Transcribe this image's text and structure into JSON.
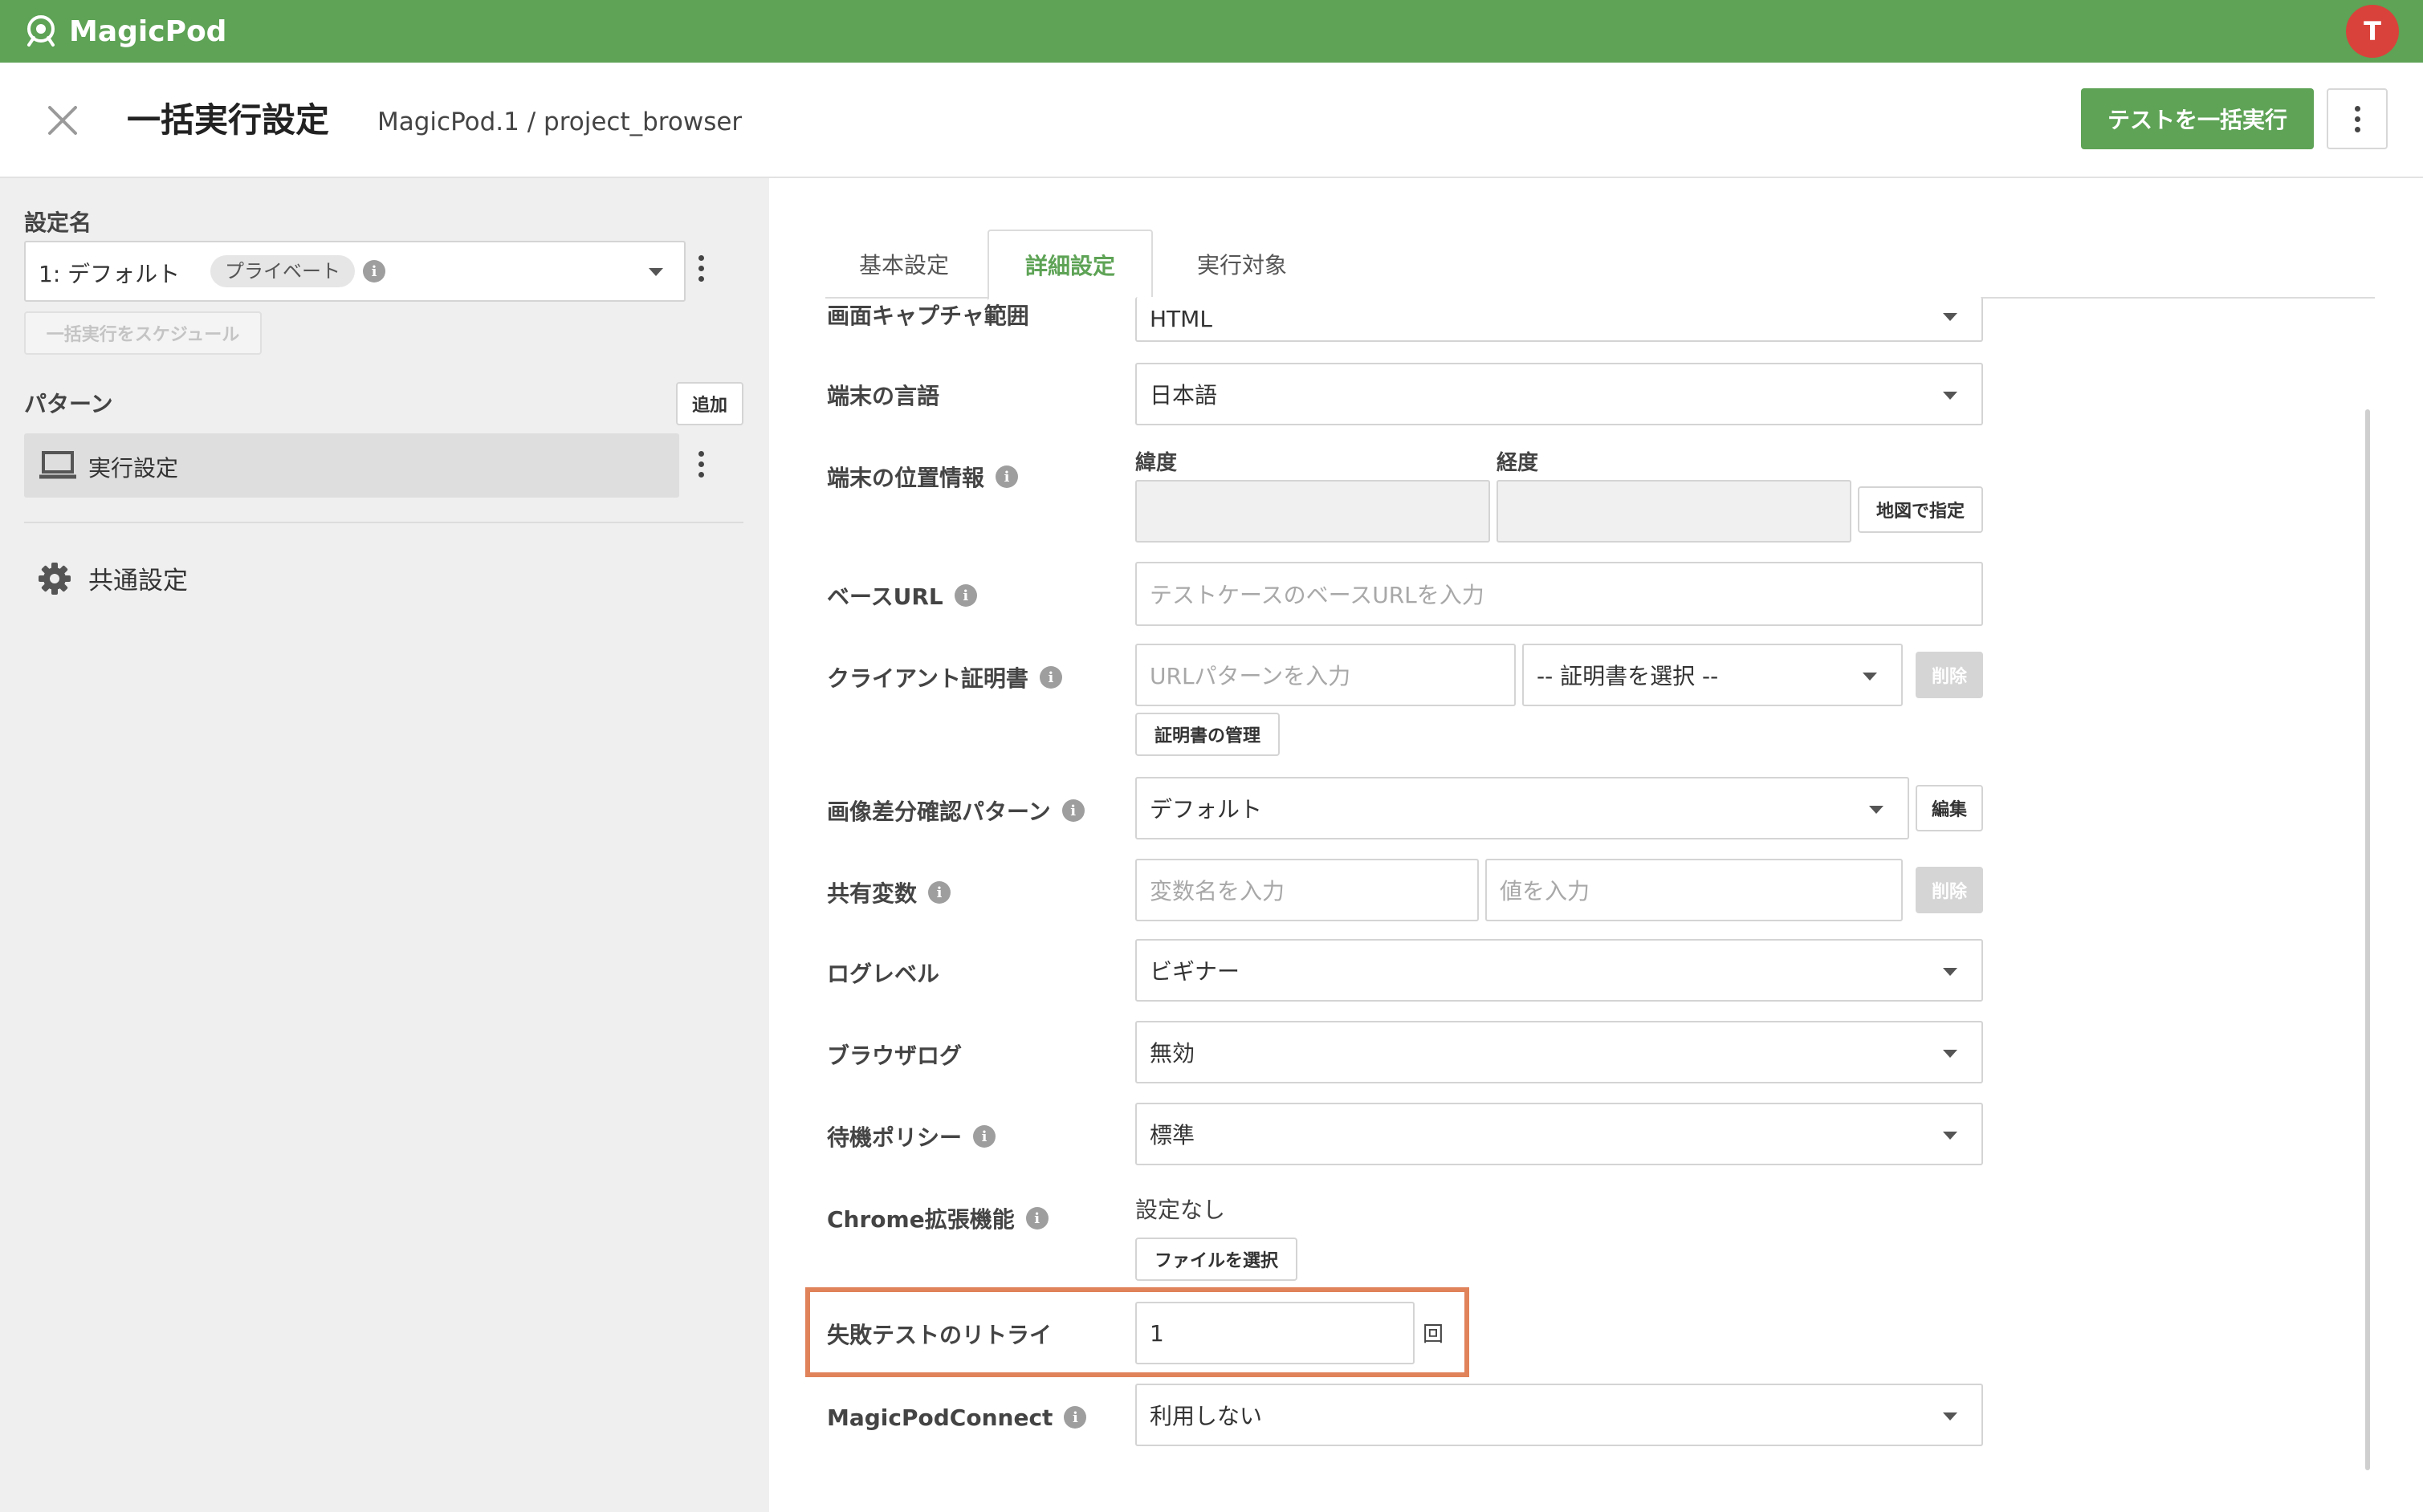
{
  "app": {
    "name": "MagicPod",
    "user_initial": "T"
  },
  "colors": {
    "brand_green": "#5ea356",
    "avatar_red": "#d9423a",
    "highlight_orange": "#e0825a"
  },
  "header": {
    "title": "一括実行設定",
    "breadcrumb": "MagicPod.1 / project_browser",
    "run_all_label": "テストを一括実行"
  },
  "sidebar": {
    "setting_name_label": "設定名",
    "selected_setting": "1: デフォルト",
    "private_badge": "プライベート",
    "schedule_label": "一括実行をスケジュール",
    "pattern_label": "パターン",
    "add_label": "追加",
    "pattern_item": "実行設定",
    "common_settings": "共通設定"
  },
  "tabs": [
    {
      "label": "基本設定",
      "active": false
    },
    {
      "label": "詳細設定",
      "active": true
    },
    {
      "label": "実行対象",
      "active": false
    }
  ],
  "form": {
    "screen_capture": {
      "label": "画面キャプチャ範囲",
      "value": "HTML"
    },
    "device_language": {
      "label": "端末の言語",
      "value": "日本語"
    },
    "device_location": {
      "label": "端末の位置情報",
      "lat_label": "緯度",
      "lng_label": "経度",
      "map_button": "地図で指定"
    },
    "base_url": {
      "label": "ベースURL",
      "placeholder": "テストケースのベースURLを入力"
    },
    "client_cert": {
      "label": "クライアント証明書",
      "url_placeholder": "URLパターンを入力",
      "cert_select": "-- 証明書を選択 --",
      "delete_button": "削除",
      "manage_button": "証明書の管理"
    },
    "image_diff": {
      "label": "画像差分確認パターン",
      "value": "デフォルト",
      "edit_button": "編集"
    },
    "shared_vars": {
      "label": "共有変数",
      "name_placeholder": "変数名を入力",
      "value_placeholder": "値を入力",
      "delete_button": "削除"
    },
    "log_level": {
      "label": "ログレベル",
      "value": "ビギナー"
    },
    "browser_log": {
      "label": "ブラウザログ",
      "value": "無効"
    },
    "wait_policy": {
      "label": "待機ポリシー",
      "value": "標準"
    },
    "chrome_ext": {
      "label": "Chrome拡張機能",
      "status": "設定なし",
      "file_button": "ファイルを選択"
    },
    "retry": {
      "label": "失敗テストのリトライ",
      "value": "1",
      "unit": "回"
    },
    "magicpod_connect": {
      "label": "MagicPodConnect",
      "value": "利用しない"
    }
  }
}
